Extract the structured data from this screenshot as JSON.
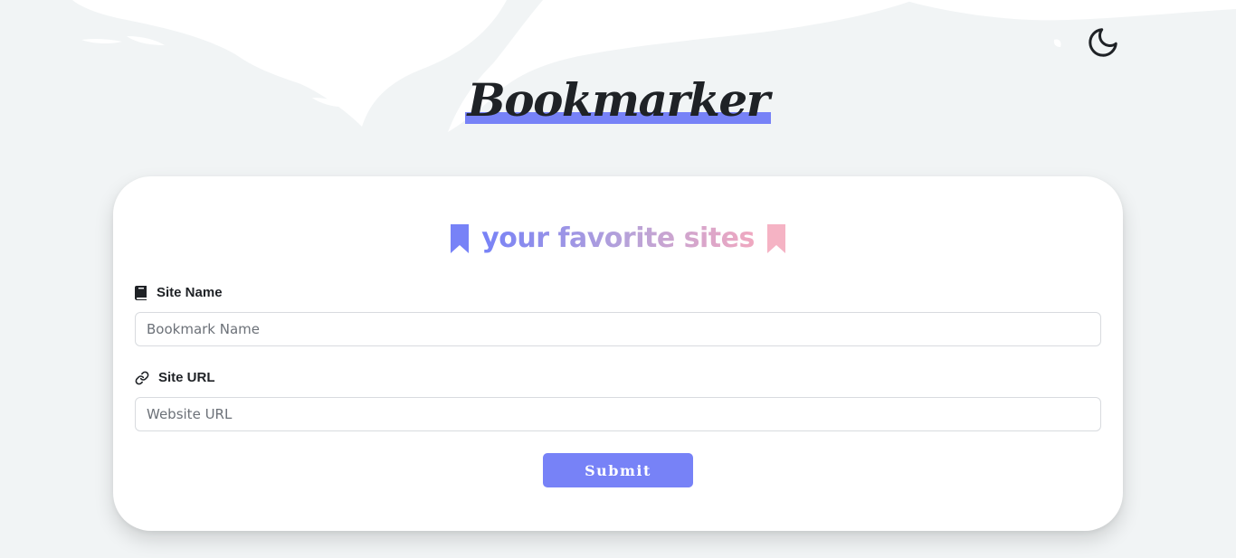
{
  "header": {
    "brand_title": "Bookmarker",
    "theme_toggle_icon": "moon-icon"
  },
  "form": {
    "heading": "your favorite sites",
    "heading_left_icon": "bookmark-icon",
    "heading_right_icon": "bookmark-icon",
    "fields": [
      {
        "label": "Site Name",
        "icon": "book-icon",
        "placeholder": "Bookmark Name",
        "value": ""
      },
      {
        "label": "Site URL",
        "icon": "link-icon",
        "placeholder": "Website URL",
        "value": ""
      }
    ],
    "submit_label": "Submit"
  },
  "colors": {
    "accent": "#7782f7",
    "heading_gradient_start": "#7782f7",
    "heading_gradient_end": "#f0a8c0",
    "bookmark_pink": "#f5b3c4",
    "text_dark": "#1f2226",
    "page_background": "#f1f4f5",
    "card_background": "#ffffff"
  }
}
